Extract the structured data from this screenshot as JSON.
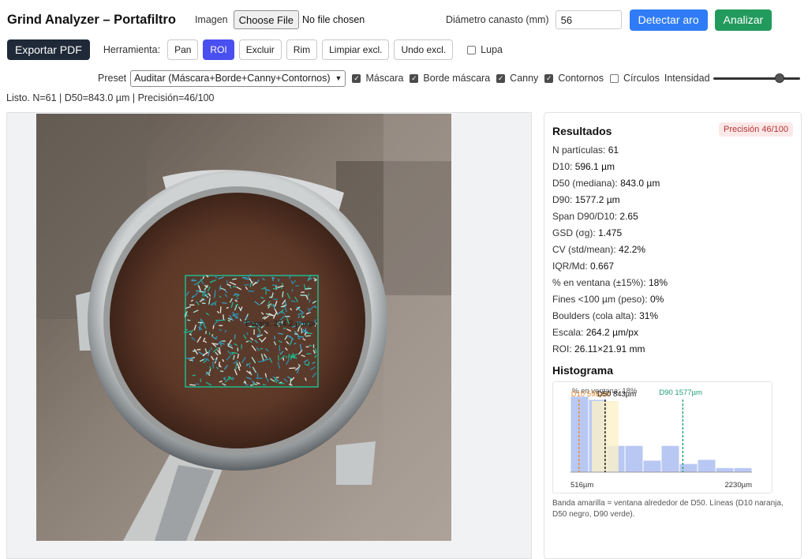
{
  "app": {
    "title": "Grind Analyzer – Portafiltro"
  },
  "toolbar1": {
    "image_label": "Imagen",
    "file_button": "Choose File",
    "file_status": "No file chosen",
    "diameter_label": "Diámetro canasto (mm)",
    "diameter_value": "56",
    "detect_button": "Detectar aro",
    "analyze_button": "Analizar"
  },
  "toolbar2": {
    "export_button": "Exportar PDF",
    "tool_label": "Herramienta:",
    "tools": [
      "Pan",
      "ROI",
      "Excluir",
      "Rim",
      "Limpiar excl.",
      "Undo excl."
    ],
    "active_tool": "ROI",
    "magnifier_label": "Lupa",
    "magnifier_checked": false
  },
  "toolbar3": {
    "preset_label": "Preset",
    "preset_value": "Auditar (Máscara+Borde+Canny+Contornos)",
    "layers": [
      {
        "label": "Máscara",
        "checked": true
      },
      {
        "label": "Borde máscara",
        "checked": true
      },
      {
        "label": "Canny",
        "checked": true
      },
      {
        "label": "Contornos",
        "checked": true
      },
      {
        "label": "Círculos",
        "checked": false
      }
    ],
    "intensity_label": "Intensidad",
    "intensity_fraction": 0.8
  },
  "status": {
    "text": "Listo. N=61 | D50=843.0 µm | Precisión=46/100"
  },
  "canvas": {
    "overlay_text": "Escala: 264.2 µm/px"
  },
  "results": {
    "title": "Resultados",
    "badge": "Precisión 46/100",
    "metrics": [
      {
        "label": "N partículas:",
        "value": "61"
      },
      {
        "label": "D10:",
        "value": "596.1 µm"
      },
      {
        "label": "D50 (mediana):",
        "value": "843.0 µm"
      },
      {
        "label": "D90:",
        "value": "1577.2 µm"
      },
      {
        "label": "Span D90/D10:",
        "value": "2.65"
      },
      {
        "label": "GSD (σg):",
        "value": "1.475"
      },
      {
        "label": "CV (std/mean):",
        "value": "42.2%"
      },
      {
        "label": "IQR/Md:",
        "value": "0.667"
      },
      {
        "label": "% en ventana (±15%):",
        "value": "18%"
      },
      {
        "label": "Fines <100 µm (peso):",
        "value": "0%"
      },
      {
        "label": "Boulders (cola alta):",
        "value": "31%"
      },
      {
        "label": "Escala:",
        "value": "264.2 µm/px"
      },
      {
        "label": "ROI:",
        "value": "26.11×21.91 mm"
      }
    ],
    "histogram_title": "Histograma",
    "histogram_note": "Banda amarilla = ventana alrededor de D50. Líneas (D10 naranja, D50 negro, D90 verde)."
  },
  "chart_data": {
    "type": "bar",
    "title": "",
    "x_min_label": "516µm",
    "x_max_label": "2230µm",
    "xlim": [
      516,
      2230
    ],
    "values": [
      0.92,
      0.88,
      0.32,
      0.32,
      0.14,
      0.32,
      0.1,
      0.15,
      0.05,
      0.05
    ],
    "window_label": "% en ventana: 18%",
    "d10_label": "D10 596µm",
    "d50_label": "D50 843µm",
    "d90_label": "D90 1577µm",
    "d10": 596,
    "d50": 843,
    "d90": 1577,
    "window": [
      717,
      969
    ],
    "colors": {
      "bar": "#b9c8f3",
      "window": "#fbf1c7",
      "d10": "#e6892a",
      "d50": "#111111",
      "d90": "#1e9e70"
    }
  }
}
